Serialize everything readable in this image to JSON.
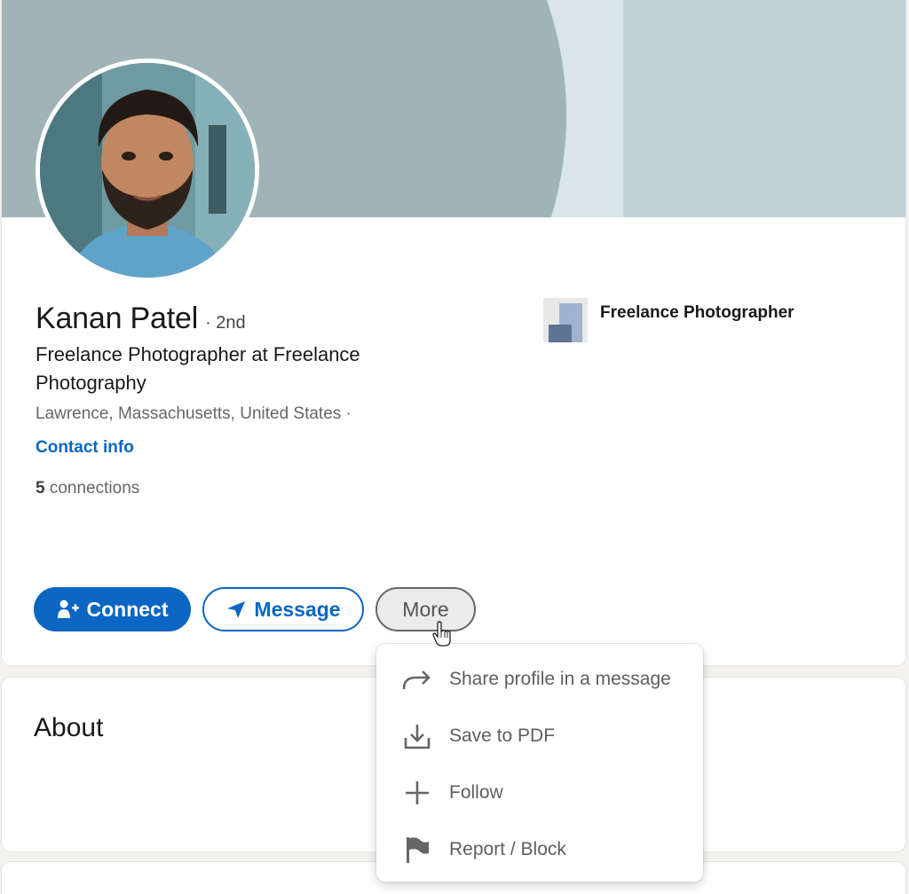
{
  "profile": {
    "name": "Kanan Patel",
    "degree": "· 2nd",
    "headline": "Freelance Photographer at Freelance Photography",
    "location": "Lawrence, Massachusetts, United States ·",
    "contact_info": "Contact info",
    "connections_count": "5",
    "connections_label": "connections"
  },
  "company": {
    "name": "Freelance Photographer"
  },
  "actions": {
    "connect": "Connect",
    "message": "Message",
    "more": "More"
  },
  "more_menu": {
    "items": [
      {
        "label": "Share profile in a message",
        "icon": "share-arrow-icon"
      },
      {
        "label": "Save to PDF",
        "icon": "download-icon"
      },
      {
        "label": "Follow",
        "icon": "plus-icon"
      },
      {
        "label": "Report / Block",
        "icon": "flag-icon"
      }
    ]
  },
  "about": {
    "title": "About"
  },
  "colors": {
    "accent": "#0a66c2",
    "banner": "#a0b4b7"
  }
}
